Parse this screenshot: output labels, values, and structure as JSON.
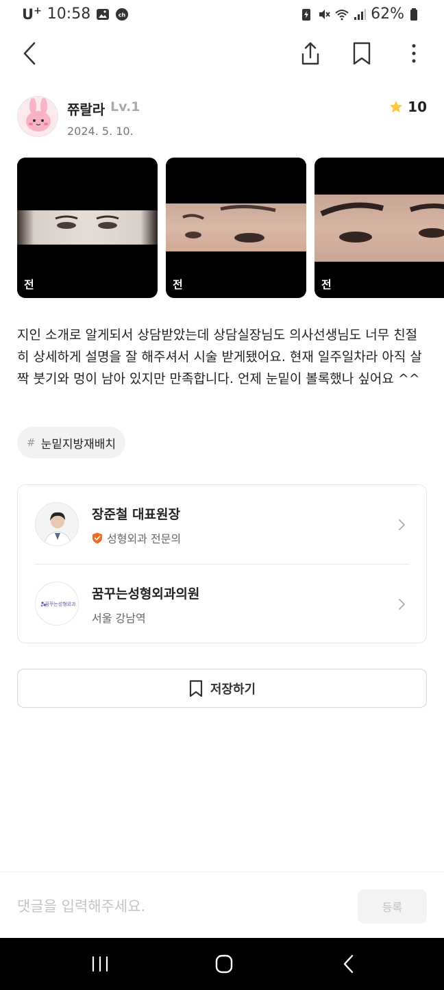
{
  "status_bar": {
    "carrier": "U",
    "carrier_sup": "+",
    "time": "10:58",
    "battery": "62%"
  },
  "app_bar": {
    "icons": [
      "back-icon",
      "share-icon",
      "bookmark-icon",
      "more-vertical-icon"
    ]
  },
  "author": {
    "name": "쮸랄라",
    "level": "Lv.1",
    "date": "2024. 5. 10.",
    "rating": "10"
  },
  "photos": [
    {
      "label": "전"
    },
    {
      "label": "전"
    },
    {
      "label": "전"
    }
  ],
  "review": {
    "text": "지인 소개로 알게되서 상담받았는데 상담실장님도 의사선생님도 너무 친절히 상세하게 설명을 잘 해주셔서 시술 받게됐어요. 현재 일주일차라 아직 살짝 붓기와 멍이 남아 있지만 만족합니다. 언제 눈밑이 볼록했나 싶어요 ^^"
  },
  "tag": {
    "hash": "#",
    "label": "눈밑지방재배치"
  },
  "doctor": {
    "name": "장준철 대표원장",
    "specialty": "성형외과 전문의"
  },
  "clinic": {
    "name": "꿈꾸는성형외과의원",
    "location": "서울 강남역",
    "logo_text": "꿈꾸는성형외과"
  },
  "save_button": {
    "label": "저장하기"
  },
  "comment": {
    "placeholder": "댓글을 입력해주세요.",
    "submit_label": "등록"
  },
  "colors": {
    "star": "#FFC83D",
    "verified_badge": "#F26B21",
    "nav_bar": "#000000"
  }
}
